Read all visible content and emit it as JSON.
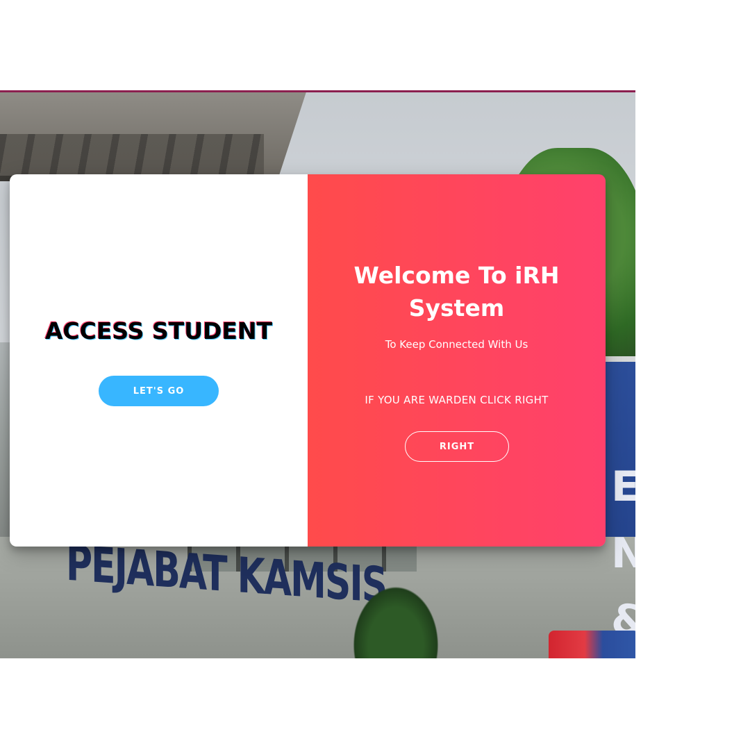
{
  "student_panel": {
    "title": "ACCESS STUDENT",
    "button_label": "LET'S GO"
  },
  "warden_panel": {
    "title": "Welcome To iRH System",
    "subtitle": "To Keep Connected With Us",
    "prompt": "IF YOU ARE WARDEN CLICK RIGHT",
    "button_label": "RIGHT"
  },
  "background": {
    "sign_text": "PEJABAT KAMSIS",
    "blue_sign_text": "EJ N &"
  },
  "colors": {
    "accent_gradient_start": "#ff4b4b",
    "accent_gradient_end": "#ff416c",
    "button_blue": "#38b6ff",
    "top_border": "#8b1f4f"
  }
}
